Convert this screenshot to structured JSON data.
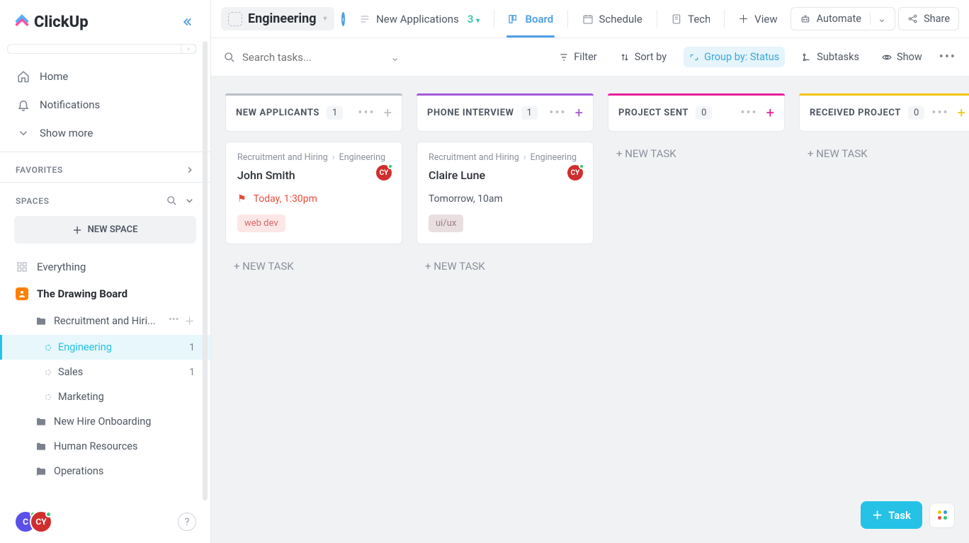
{
  "brand": {
    "name": "ClickUp"
  },
  "sidebar": {
    "nav": [
      {
        "label": "Home"
      },
      {
        "label": "Notifications"
      },
      {
        "label": "Show more"
      }
    ],
    "favorites_label": "FAVORITES",
    "spaces_label": "SPACES",
    "new_space_label": "NEW SPACE",
    "everything_label": "Everything",
    "space_name": "The Drawing Board",
    "folders": [
      {
        "label": "Recruitment and Hiri...",
        "lists": [
          {
            "label": "Engineering",
            "count": "1",
            "active": true
          },
          {
            "label": "Sales",
            "count": "1",
            "active": false
          },
          {
            "label": "Marketing",
            "count": "",
            "active": false
          }
        ]
      },
      {
        "label": "New Hire Onboarding"
      },
      {
        "label": "Human Resources"
      },
      {
        "label": "Operations"
      }
    ],
    "avatar_labels": {
      "a": "C",
      "b": "CY"
    }
  },
  "topbar": {
    "space_crumb": "Engineering",
    "list_crumb": "New Applications",
    "list_count": "3",
    "tabs": {
      "board": "Board",
      "schedule": "Schedule",
      "tech": "Tech and Engineering App"
    },
    "add_view": "View",
    "automate": "Automate",
    "share": "Share"
  },
  "toolbar": {
    "search_placeholder": "Search tasks...",
    "filter": "Filter",
    "sort_by": "Sort by",
    "group_by": "Group by: Status",
    "subtasks": "Subtasks",
    "show": "Show"
  },
  "board": {
    "new_task": "+ NEW TASK",
    "columns": [
      {
        "title": "NEW APPLICANTS",
        "count": "1",
        "color": "grey",
        "cards": [
          {
            "bc1": "Recruitment and Hiring",
            "bc2": "Engineering",
            "title": "John Smith",
            "avatar": "CY",
            "due": "Today, 1:30pm",
            "due_color": "red",
            "flag": true,
            "tag": "web dev",
            "tag_style": "pink"
          }
        ]
      },
      {
        "title": "PHONE INTERVIEW",
        "count": "1",
        "color": "purple",
        "cards": [
          {
            "bc1": "Recruitment and Hiring",
            "bc2": "Engineering",
            "title": "Claire Lune",
            "avatar": "CY",
            "due": "Tomorrow, 10am",
            "due_color": "grey",
            "flag": false,
            "tag": "ui/ux",
            "tag_style": "mauve"
          }
        ]
      },
      {
        "title": "PROJECT SENT",
        "count": "0",
        "color": "pink",
        "cards": []
      },
      {
        "title": "RECEIVED PROJECT",
        "count": "0",
        "color": "yellow",
        "cards": []
      }
    ]
  },
  "fab": {
    "task": "Task"
  }
}
